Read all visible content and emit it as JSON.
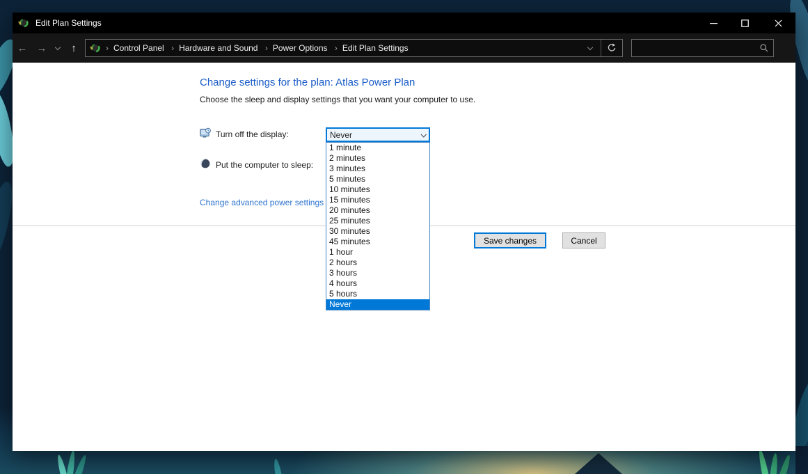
{
  "titlebar": {
    "title": "Edit Plan Settings",
    "app_icon": "power-options-icon",
    "controls": [
      "minimize-icon",
      "maximize-icon",
      "close-icon"
    ]
  },
  "navbar": {
    "breadcrumb_separator": "›",
    "back_glyph": "←",
    "forward_glyph": "→",
    "up_glyph": "↑",
    "breadcrumb": [
      "Control Panel",
      "Hardware and Sound",
      "Power Options",
      "Edit Plan Settings"
    ],
    "search": {
      "value": "",
      "placeholder": ""
    }
  },
  "content": {
    "heading": "Change settings for the plan: Atlas Power Plan",
    "subheading": "Choose the sleep and display settings that you want your computer to use.",
    "rows": [
      {
        "icon": "display-clock-icon",
        "label": "Turn off the display:",
        "value": "Never"
      },
      {
        "icon": "sleep-moon-icon",
        "label": "Put the computer to sleep:"
      }
    ],
    "dropdown": {
      "selected": "Never",
      "options": [
        {
          "label": "1 minute"
        },
        {
          "label": "2 minutes"
        },
        {
          "label": "3 minutes"
        },
        {
          "label": "5 minutes"
        },
        {
          "label": "10 minutes"
        },
        {
          "label": "15 minutes"
        },
        {
          "label": "20 minutes"
        },
        {
          "label": "25 minutes"
        },
        {
          "label": "30 minutes"
        },
        {
          "label": "45 minutes"
        },
        {
          "label": "1 hour"
        },
        {
          "label": "2 hours"
        },
        {
          "label": "3 hours"
        },
        {
          "label": "4 hours"
        },
        {
          "label": "5 hours"
        },
        {
          "label": "Never",
          "selected": true
        }
      ]
    },
    "advanced_link": "Change advanced power settings",
    "buttons": {
      "save": "Save changes",
      "cancel": "Cancel"
    }
  },
  "colors": {
    "accent": "#0078d7",
    "heading": "#1a5cc8",
    "link": "#2e74cf",
    "titlebar_bg": "#000000",
    "navbar_bg": "#161616",
    "selected_item_bg": "#0078d7"
  }
}
